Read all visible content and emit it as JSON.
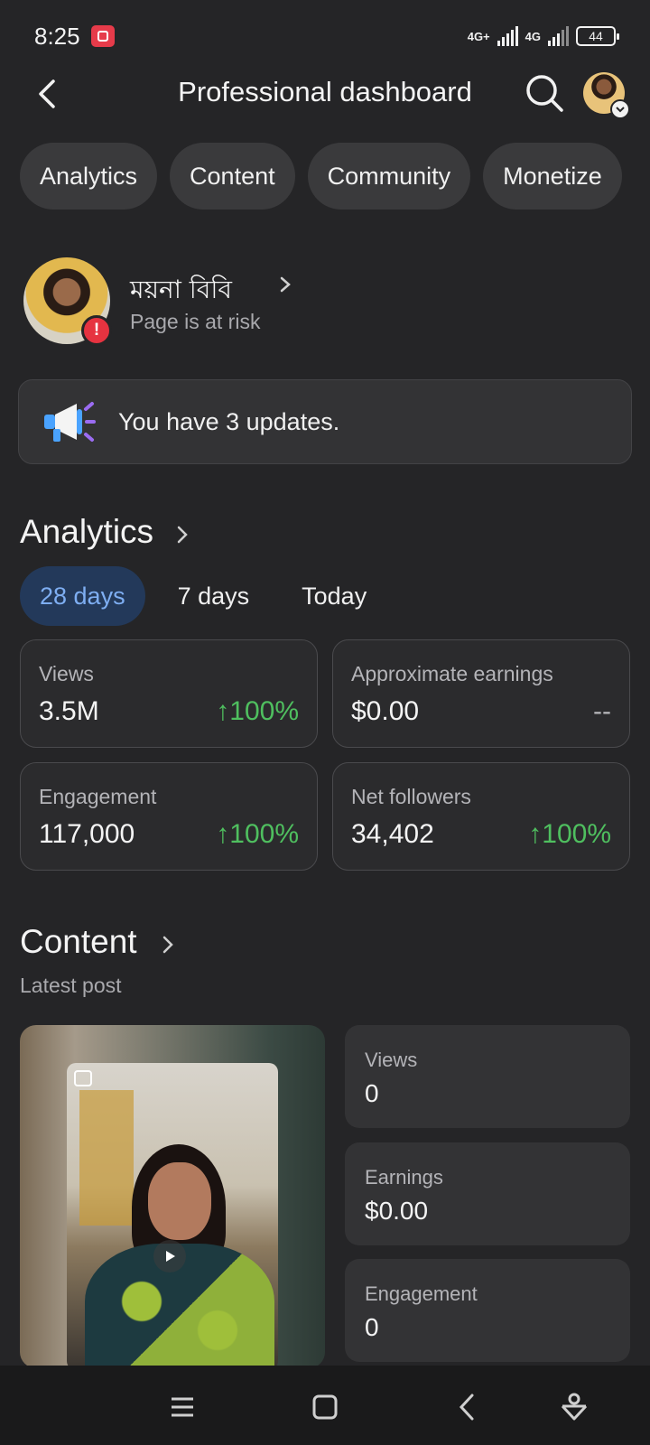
{
  "status_bar": {
    "time": "8:25",
    "network1": "4G+",
    "network2": "4G",
    "battery": "44"
  },
  "header": {
    "title": "Professional dashboard"
  },
  "tabs": [
    {
      "label": "Analytics"
    },
    {
      "label": "Content"
    },
    {
      "label": "Community"
    },
    {
      "label": "Monetize"
    }
  ],
  "profile": {
    "name": "ময়না বিবি",
    "status": "Page is at risk",
    "badge": "!"
  },
  "updates": {
    "text": "You have 3 updates."
  },
  "analytics": {
    "title": "Analytics",
    "ranges": [
      {
        "label": "28 days",
        "active": true
      },
      {
        "label": "7 days",
        "active": false
      },
      {
        "label": "Today",
        "active": false
      }
    ],
    "cards": [
      {
        "label": "Views",
        "value": "3.5M",
        "change": "100%"
      },
      {
        "label": "Approximate earnings",
        "value": "$0.00",
        "change": "--"
      },
      {
        "label": "Engagement",
        "value": "117,000",
        "change": "100%"
      },
      {
        "label": "Net followers",
        "value": "34,402",
        "change": "100%"
      }
    ]
  },
  "content": {
    "title": "Content",
    "subtitle": "Latest post",
    "metrics": [
      {
        "label": "Views",
        "value": "0"
      },
      {
        "label": "Earnings",
        "value": "$0.00"
      },
      {
        "label": "Engagement",
        "value": "0"
      }
    ]
  },
  "colors": {
    "background": "#252527",
    "accent_blue": "#7eaef2",
    "positive_green": "#4fbf5f",
    "alert_red": "#e63340"
  },
  "icons": {
    "back": "back-icon",
    "search": "search-icon",
    "megaphone": "megaphone-icon",
    "nav": [
      "menu-icon",
      "home-square-icon",
      "back-nav-icon",
      "assistant-icon"
    ]
  }
}
